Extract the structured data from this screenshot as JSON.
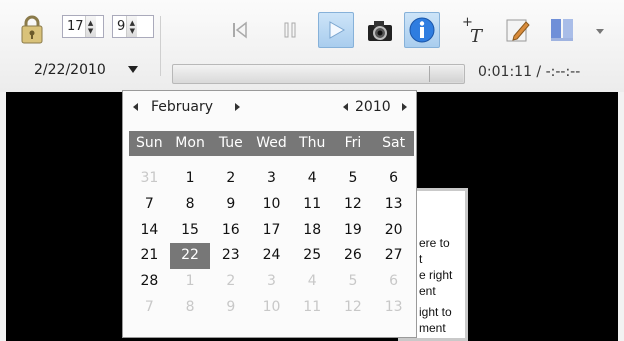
{
  "toolbar": {
    "spinner_a": "17",
    "spinner_b": "9",
    "date": "2/22/2010",
    "time": "0:01:11 / -:--:--",
    "buttons": [
      {
        "icon": "skip-to-start-icon"
      },
      {
        "icon": "pause-icon"
      },
      {
        "icon": "play-icon",
        "active": true
      },
      {
        "icon": "camera-icon"
      },
      {
        "icon": "info-icon",
        "active": true
      },
      {
        "icon": "add-text-icon"
      },
      {
        "icon": "edit-note-icon"
      },
      {
        "icon": "layout-icon"
      }
    ]
  },
  "calendar": {
    "month": "February",
    "year": "2010",
    "weekdays": [
      "Sun",
      "Mon",
      "Tue",
      "Wed",
      "Thu",
      "Fri",
      "Sat"
    ],
    "days": [
      {
        "d": "31",
        "muted": true
      },
      {
        "d": "1"
      },
      {
        "d": "2"
      },
      {
        "d": "3"
      },
      {
        "d": "4"
      },
      {
        "d": "5"
      },
      {
        "d": "6"
      },
      {
        "d": "7"
      },
      {
        "d": "8"
      },
      {
        "d": "9"
      },
      {
        "d": "10"
      },
      {
        "d": "11"
      },
      {
        "d": "12"
      },
      {
        "d": "13"
      },
      {
        "d": "14"
      },
      {
        "d": "15"
      },
      {
        "d": "16"
      },
      {
        "d": "17"
      },
      {
        "d": "18"
      },
      {
        "d": "19"
      },
      {
        "d": "20"
      },
      {
        "d": "21"
      },
      {
        "d": "22",
        "selected": true
      },
      {
        "d": "23"
      },
      {
        "d": "24"
      },
      {
        "d": "25"
      },
      {
        "d": "26"
      },
      {
        "d": "27"
      },
      {
        "d": "28"
      },
      {
        "d": "1",
        "muted": true
      },
      {
        "d": "2",
        "muted": true
      },
      {
        "d": "3",
        "muted": true
      },
      {
        "d": "4",
        "muted": true
      },
      {
        "d": "5",
        "muted": true
      },
      {
        "d": "6",
        "muted": true
      },
      {
        "d": "7",
        "muted": true
      },
      {
        "d": "8",
        "muted": true
      },
      {
        "d": "9",
        "muted": true
      },
      {
        "d": "10",
        "muted": true
      },
      {
        "d": "11",
        "muted": true
      },
      {
        "d": "12",
        "muted": true
      },
      {
        "d": "13",
        "muted": true
      }
    ]
  },
  "note": {
    "lines": [
      "ere to",
      "t",
      "e right",
      "ent",
      "ight to",
      "ment"
    ]
  },
  "colors": {
    "selection": "#777777",
    "active_button": "#a9cdee"
  }
}
